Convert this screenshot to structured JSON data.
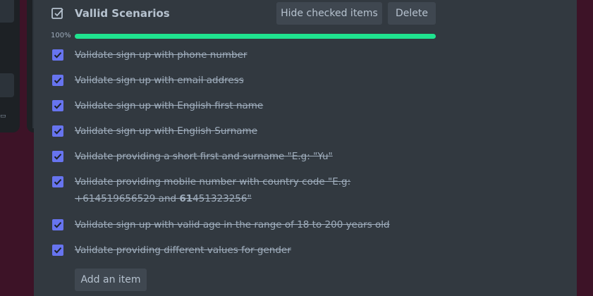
{
  "checklist": {
    "title": "Vallid Scenarios",
    "hide_label": "Hide checked items",
    "delete_label": "Delete",
    "progress_text": "100%",
    "progress": 1.0,
    "add_label": "Add an item",
    "items": [
      {
        "text": "Validate sign up with phone number",
        "checked": true
      },
      {
        "text": "Validate sign up with email address",
        "checked": true
      },
      {
        "text": "Validate sign up with English first name",
        "checked": true
      },
      {
        "text": "Validate sign up with English Surname",
        "checked": true
      },
      {
        "text": "Validate providing a short first and surname \"E.g: \"Yu\"",
        "checked": true
      },
      {
        "text_line1": "Validate providing mobile number with country code \"E.g:",
        "text_line2_a": "+614519656529 and ",
        "text_line2_b": "61",
        "text_line2_c": "451323256\"",
        "checked": true
      },
      {
        "text": "Validate sign up with valid age in the range of 18 to 200 years old",
        "checked": true
      },
      {
        "text": "Validate providing different values for gender",
        "checked": true
      }
    ]
  },
  "colors": {
    "accent": "#1fe38f",
    "checkbox": "#6774ef",
    "card": "#323940",
    "background": "#3d1327"
  }
}
